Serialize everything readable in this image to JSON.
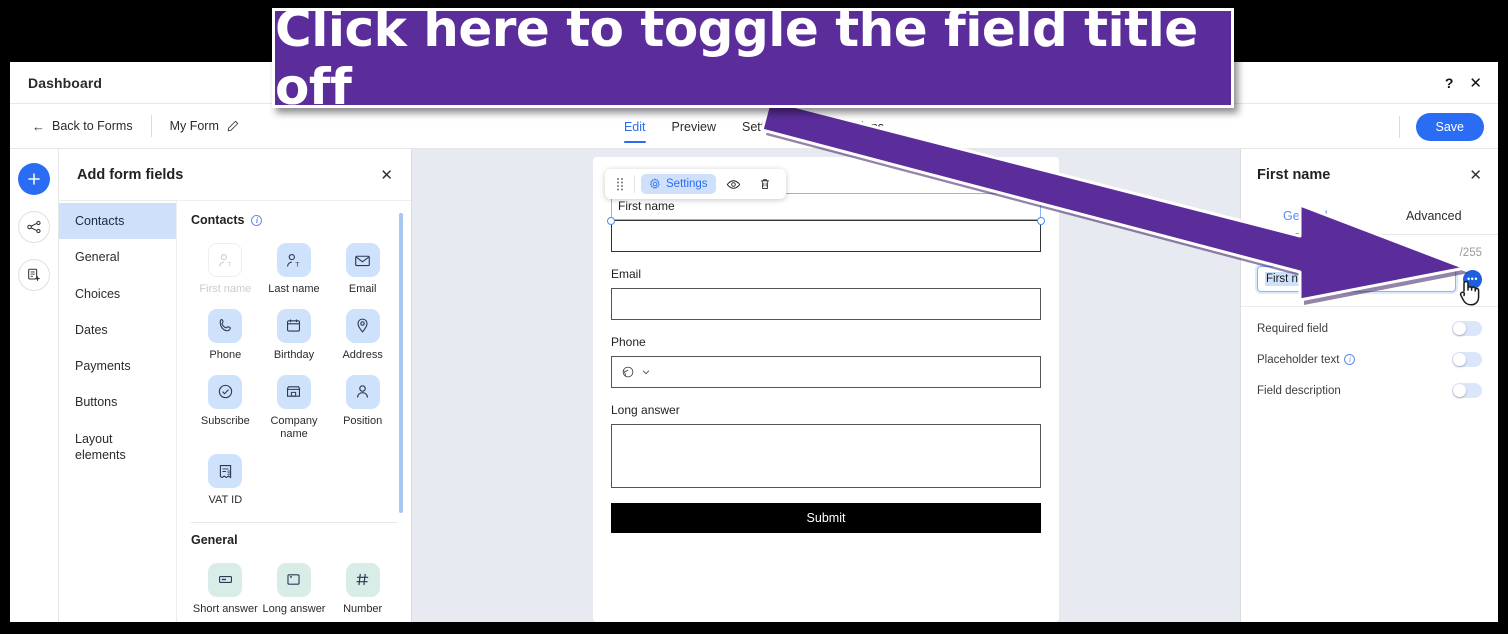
{
  "callout": {
    "text": "Click here to toggle the field title off",
    "bg_color": "#5B2D9B"
  },
  "titlebar": {
    "title": "Dashboard",
    "help_icon": "question-mark-icon",
    "close_icon": "close-icon"
  },
  "toolbar": {
    "back_label": "Back to Forms",
    "form_name": "My Form",
    "edit_icon": "pencil-icon",
    "save_label": "Save",
    "accent_color": "#2a6df4",
    "tabs": [
      {
        "label": "Edit",
        "active": true
      },
      {
        "label": "Preview",
        "active": false
      },
      {
        "label": "Settings",
        "active": false
      },
      {
        "label": "Submissions",
        "active": false
      }
    ]
  },
  "left_rail": {
    "items": [
      {
        "icon": "plus-icon",
        "name": "add-element-button"
      },
      {
        "icon": "branching-rules-icon",
        "name": "rules-button"
      },
      {
        "icon": "add-page-icon",
        "name": "add-page-button"
      }
    ]
  },
  "fields_panel": {
    "title": "Add form fields",
    "close_icon": "close-icon",
    "categories": [
      {
        "label": "Contacts",
        "active": true
      },
      {
        "label": "General",
        "active": false
      },
      {
        "label": "Choices",
        "active": false
      },
      {
        "label": "Dates",
        "active": false
      },
      {
        "label": "Payments",
        "active": false
      },
      {
        "label": "Buttons",
        "active": false
      },
      {
        "label": "Layout elements",
        "active": false
      }
    ],
    "sections": [
      {
        "title": "Contacts",
        "has_info": true,
        "style": "blue",
        "tiles": [
          {
            "label": "First name",
            "icon": "person-text-icon",
            "disabled": true
          },
          {
            "label": "Last name",
            "icon": "person-text-icon",
            "disabled": false
          },
          {
            "label": "Email",
            "icon": "envelope-icon",
            "disabled": false
          },
          {
            "label": "Phone",
            "icon": "phone-icon",
            "disabled": false
          },
          {
            "label": "Birthday",
            "icon": "calendar-icon",
            "disabled": false
          },
          {
            "label": "Address",
            "icon": "map-pin-icon",
            "disabled": false
          },
          {
            "label": "Subscribe",
            "icon": "check-circle-icon",
            "disabled": false
          },
          {
            "label": "Company name",
            "icon": "store-icon",
            "disabled": false
          },
          {
            "label": "Position",
            "icon": "person-icon",
            "disabled": false
          },
          {
            "label": "VAT ID",
            "icon": "receipt-dollar-icon",
            "disabled": false
          }
        ]
      },
      {
        "title": "General",
        "has_info": false,
        "style": "green",
        "tiles": [
          {
            "label": "Short answer",
            "icon": "short-text-icon",
            "disabled": false
          },
          {
            "label": "Long answer",
            "icon": "long-text-icon",
            "disabled": false
          },
          {
            "label": "Number",
            "icon": "hash-icon",
            "disabled": false
          }
        ]
      }
    ]
  },
  "canvas": {
    "field_toolbar": {
      "drag_icon": "drag-handle-icon",
      "settings_label": "Settings",
      "settings_icon": "gear-icon",
      "hide_icon": "eye-icon",
      "delete_icon": "trash-icon"
    },
    "fields": [
      {
        "label": "First name",
        "type": "text",
        "selected": true
      },
      {
        "label": "Email",
        "type": "text",
        "selected": false
      },
      {
        "label": "Phone",
        "type": "phone",
        "selected": false
      },
      {
        "label": "Long answer",
        "type": "textarea",
        "selected": false
      }
    ],
    "phone_country_icon": "globe-icon",
    "phone_chevron_icon": "chevron-down-icon",
    "submit_label": "Submit"
  },
  "settings_panel": {
    "title": "First name",
    "close_icon": "close-icon",
    "tabs": [
      {
        "label": "General",
        "active": true
      },
      {
        "label": "Advanced",
        "active": false
      }
    ],
    "field_title": {
      "label": "Field title",
      "info_icon": "info-icon",
      "counter": "/255",
      "value": "First name",
      "more_icon": "more-options-icon"
    },
    "toggles": [
      {
        "label": "Required field",
        "has_info": false,
        "on": false
      },
      {
        "label": "Placeholder text",
        "has_info": true,
        "on": false
      },
      {
        "label": "Field description",
        "has_info": false,
        "on": false
      }
    ]
  }
}
